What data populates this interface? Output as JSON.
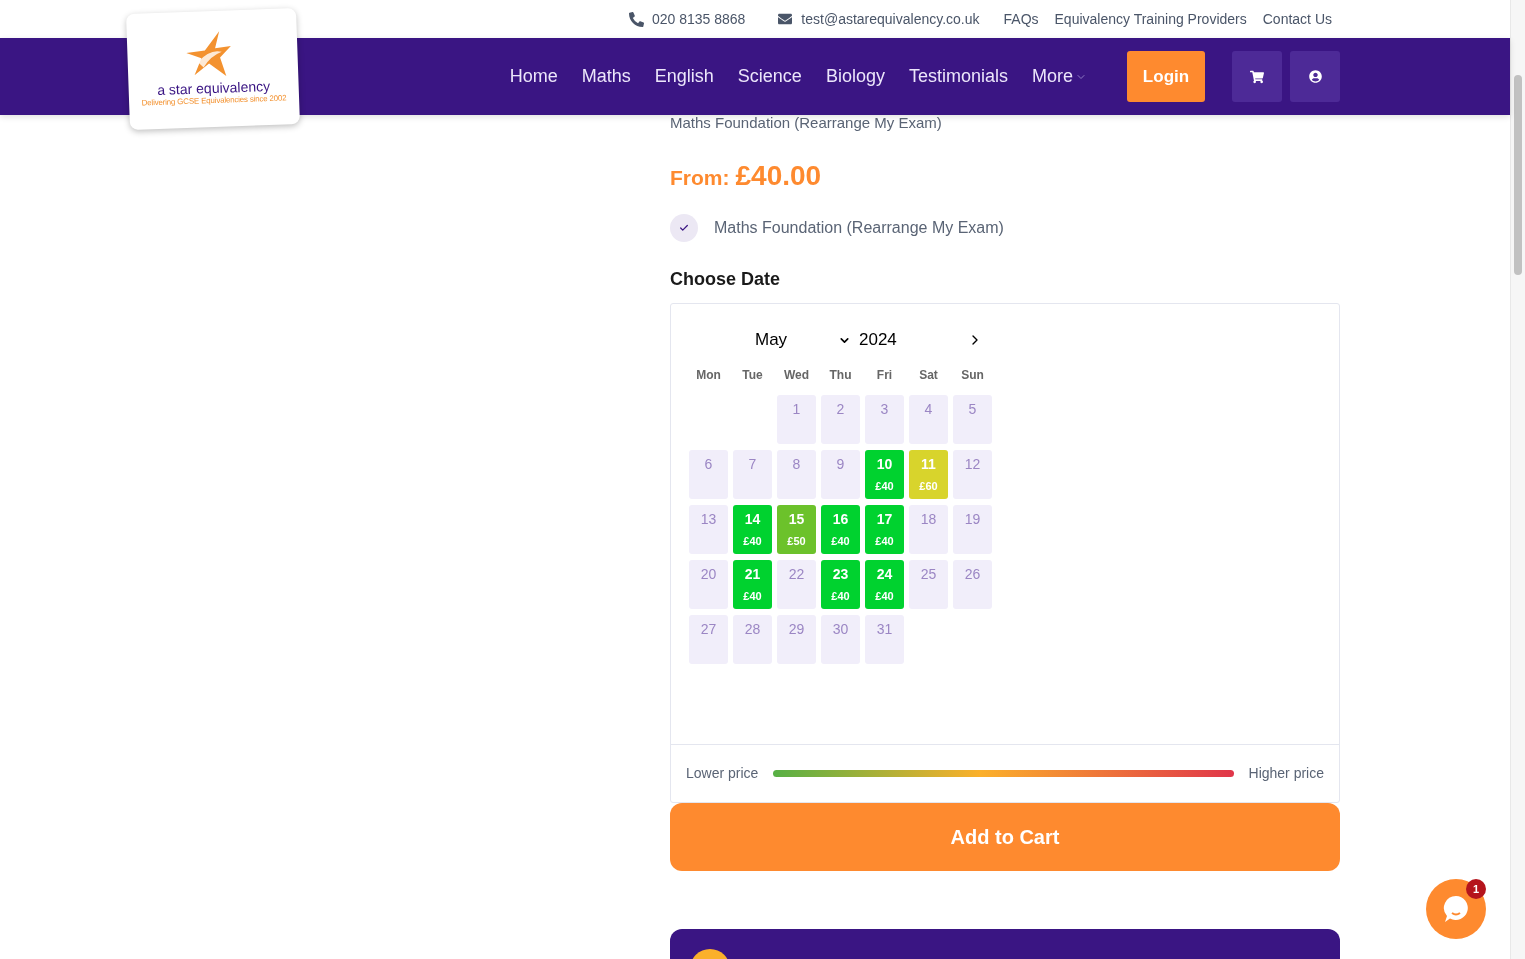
{
  "top_bar": {
    "phone": "020 8135 8868",
    "email": "test@astarequivalency.co.uk",
    "links": [
      "FAQs",
      "Equivalency Training Providers",
      "Contact Us"
    ]
  },
  "logo": {
    "name": "a star equivalency",
    "tagline": "Delivering GCSE Equivalencies since 2002"
  },
  "nav": {
    "items": [
      {
        "label": "Home",
        "dropdown": false
      },
      {
        "label": "Maths",
        "dropdown": false
      },
      {
        "label": "English",
        "dropdown": false
      },
      {
        "label": "Science",
        "dropdown": false
      },
      {
        "label": "Biology",
        "dropdown": false
      },
      {
        "label": "Testimonials",
        "dropdown": false
      },
      {
        "label": "More",
        "dropdown": true
      }
    ],
    "login": "Login"
  },
  "product": {
    "title": "Maths Foundation (Rearrange My Exam)",
    "price_label": "From:",
    "price": "£40.00",
    "option": {
      "label": "Maths Foundation (Rearrange My Exam)",
      "checked": true
    }
  },
  "calendar": {
    "heading": "Choose Date",
    "month": "May",
    "year": "2024",
    "weekdays": [
      "Mon",
      "Tue",
      "Wed",
      "Thu",
      "Fri",
      "Sat",
      "Sun"
    ],
    "weeks": [
      [
        {
          "kind": "blank"
        },
        {
          "kind": "blank"
        },
        {
          "kind": "unavailable",
          "day": "1"
        },
        {
          "kind": "unavailable",
          "day": "2"
        },
        {
          "kind": "unavailable",
          "day": "3"
        },
        {
          "kind": "unavailable",
          "day": "4"
        },
        {
          "kind": "unavailable",
          "day": "5"
        }
      ],
      [
        {
          "kind": "unavailable",
          "day": "6"
        },
        {
          "kind": "unavailable",
          "day": "7"
        },
        {
          "kind": "unavailable",
          "day": "8"
        },
        {
          "kind": "unavailable",
          "day": "9"
        },
        {
          "kind": "available",
          "day": "10",
          "price": "£40",
          "color": "#00d22f"
        },
        {
          "kind": "available",
          "day": "11",
          "price": "£60",
          "color": "#d8d42c"
        },
        {
          "kind": "unavailable",
          "day": "12"
        }
      ],
      [
        {
          "kind": "unavailable",
          "day": "13"
        },
        {
          "kind": "available",
          "day": "14",
          "price": "£40",
          "color": "#00d22f"
        },
        {
          "kind": "available",
          "day": "15",
          "price": "£50",
          "color": "#6cc22b"
        },
        {
          "kind": "available",
          "day": "16",
          "price": "£40",
          "color": "#00d22f"
        },
        {
          "kind": "available",
          "day": "17",
          "price": "£40",
          "color": "#00d22f"
        },
        {
          "kind": "unavailable",
          "day": "18"
        },
        {
          "kind": "unavailable",
          "day": "19"
        }
      ],
      [
        {
          "kind": "unavailable",
          "day": "20"
        },
        {
          "kind": "available",
          "day": "21",
          "price": "£40",
          "color": "#00d22f"
        },
        {
          "kind": "unavailable",
          "day": "22"
        },
        {
          "kind": "available",
          "day": "23",
          "price": "£40",
          "color": "#00d22f"
        },
        {
          "kind": "available",
          "day": "24",
          "price": "£40",
          "color": "#00d22f"
        },
        {
          "kind": "unavailable",
          "day": "25"
        },
        {
          "kind": "unavailable",
          "day": "26"
        }
      ],
      [
        {
          "kind": "unavailable",
          "day": "27"
        },
        {
          "kind": "unavailable",
          "day": "28"
        },
        {
          "kind": "unavailable",
          "day": "29"
        },
        {
          "kind": "unavailable",
          "day": "30"
        },
        {
          "kind": "unavailable",
          "day": "31"
        }
      ]
    ],
    "legend": {
      "low": "Lower price",
      "high": "Higher price"
    }
  },
  "add_to_cart": "Add to Cart",
  "chat": {
    "count": "1"
  }
}
